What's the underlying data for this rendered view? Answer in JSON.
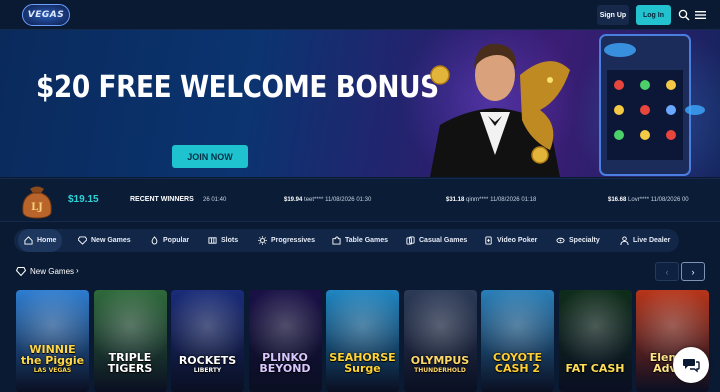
{
  "header": {
    "logo_text": "VEGAS",
    "signup_label": "Sign Up",
    "login_label": "Log In"
  },
  "hero": {
    "title": "$20 FREE WELCOME BONUS",
    "cta_label": "JOIN NOW"
  },
  "jackpot": {
    "bag_letters": "LJ",
    "amount": "$19.15"
  },
  "recent_winners": {
    "title": "RECENT WINNERS",
    "entries": [
      {
        "amount": "",
        "user": "",
        "date": "26 01:40"
      },
      {
        "amount": "$19.94",
        "user": "teet****",
        "date": "11/08/2026 01:30"
      },
      {
        "amount": "$31.18",
        "user": "qinm****",
        "date": "11/08/2026 01:18"
      },
      {
        "amount": "$16.68",
        "user": "Lovr****",
        "date": "11/08/2026 00"
      }
    ]
  },
  "categories": [
    {
      "label": "Home",
      "icon": "home-icon",
      "active": true
    },
    {
      "label": "New Games",
      "icon": "diamond-icon",
      "active": false
    },
    {
      "label": "Popular",
      "icon": "flame-icon",
      "active": false
    },
    {
      "label": "Slots",
      "icon": "slots-icon",
      "active": false
    },
    {
      "label": "Progressives",
      "icon": "sun-icon",
      "active": false
    },
    {
      "label": "Table Games",
      "icon": "puzzle-icon",
      "active": false
    },
    {
      "label": "Casual Games",
      "icon": "cards-icon",
      "active": false
    },
    {
      "label": "Video Poker",
      "icon": "poker-icon",
      "active": false
    },
    {
      "label": "Specialty",
      "icon": "specialty-icon",
      "active": false
    },
    {
      "label": "Live Dealer",
      "icon": "dealer-icon",
      "active": false
    }
  ],
  "new_games": {
    "title": "New Games",
    "chevron": "›",
    "prev_arrow": "‹",
    "next_arrow": "›",
    "games": [
      {
        "title": "WINNIE the Piggie",
        "sub": "LAS VEGAS",
        "bg": "#2e7dd0",
        "text": "#ffd84a"
      },
      {
        "title": "TRIPLE TIGERS",
        "sub": "",
        "bg": "#2f6a3b",
        "text": "#ffffff"
      },
      {
        "title": "ROCKETS",
        "sub": "LIBERTY",
        "bg": "#1a2c7a",
        "text": "#ffffff"
      },
      {
        "title": "PLINKO BEYOND",
        "sub": "",
        "bg": "#1a1046",
        "text": "#d8c7ff"
      },
      {
        "title": "SEAHORSE Surge",
        "sub": "",
        "bg": "#1f86c2",
        "text": "#ffd437"
      },
      {
        "title": "OLYMPUS",
        "sub": "THUNDERHOLD",
        "bg": "#2c3a57",
        "text": "#ffd86b"
      },
      {
        "title": "COYOTE CASH 2",
        "sub": "",
        "bg": "#2a7fb8",
        "text": "#ffcf33"
      },
      {
        "title": "FAT CASH",
        "sub": "",
        "bg": "#0f2d1a",
        "text": "#ffde59"
      },
      {
        "title": "Elemen Adven",
        "sub": "",
        "bg": "#b8351a",
        "text": "#ffe28a"
      }
    ]
  },
  "colors": {
    "accent": "#22c2cf",
    "background": "#0b1a33"
  }
}
